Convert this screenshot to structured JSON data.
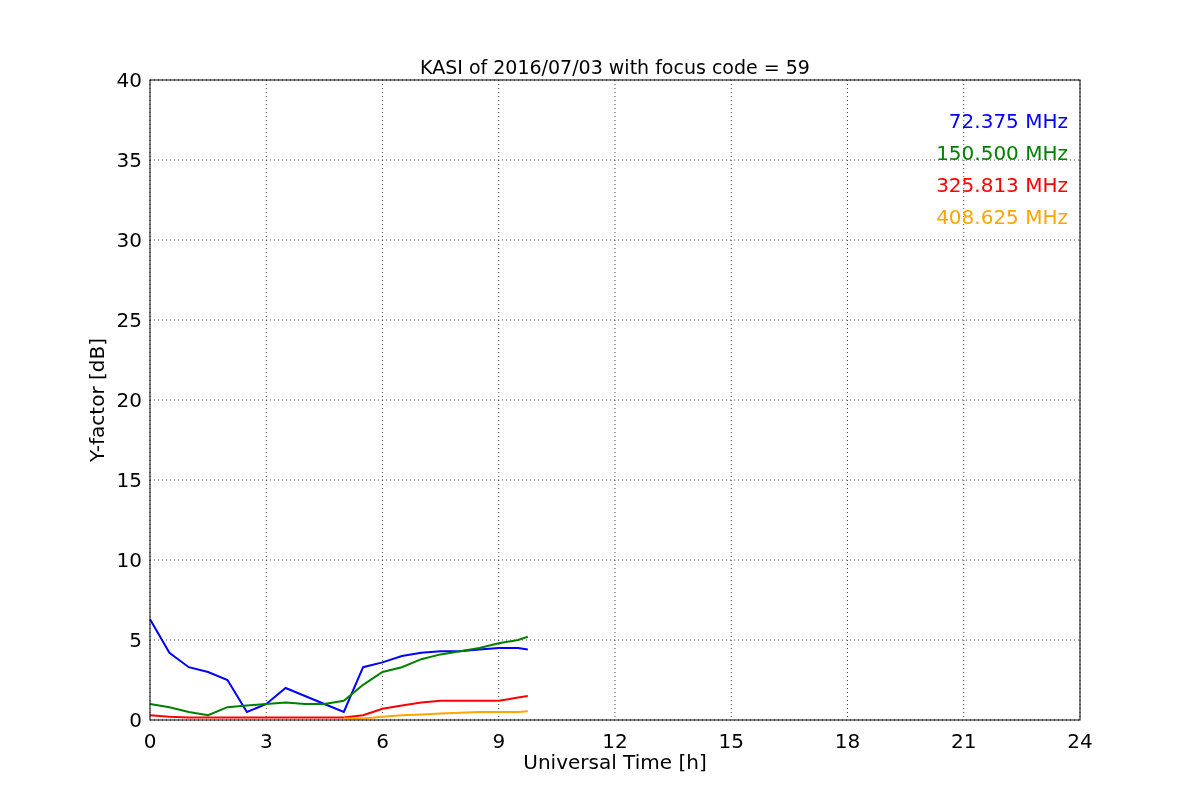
{
  "chart_data": {
    "type": "line",
    "title": "KASI of 2016/07/03 with focus code = 59",
    "xlabel": "Universal Time [h]",
    "ylabel": "Y-factor [dB]",
    "x": [
      0,
      0.5,
      1,
      1.5,
      2,
      2.5,
      3,
      3.5,
      4,
      4.5,
      5,
      5.5,
      6,
      6.5,
      7,
      7.5,
      8,
      8.5,
      9,
      9.5,
      9.75
    ],
    "series": [
      {
        "name": "72.375 MHz",
        "color": "#0000ff",
        "values": [
          6.3,
          4.2,
          3.3,
          3.0,
          2.5,
          0.5,
          1.0,
          2.0,
          1.5,
          1.0,
          0.5,
          3.3,
          3.6,
          4.0,
          4.2,
          4.3,
          4.3,
          4.4,
          4.5,
          4.5,
          4.4
        ]
      },
      {
        "name": "150.500 MHz",
        "color": "#008000",
        "values": [
          1.0,
          0.8,
          0.5,
          0.3,
          0.8,
          0.9,
          1.0,
          1.1,
          1.0,
          1.0,
          1.2,
          2.2,
          3.0,
          3.3,
          3.8,
          4.1,
          4.3,
          4.5,
          4.8,
          5.0,
          5.2
        ]
      },
      {
        "name": "325.813 MHz",
        "color": "#ff0000",
        "values": [
          0.3,
          0.2,
          0.15,
          0.15,
          0.15,
          0.15,
          0.15,
          0.15,
          0.15,
          0.15,
          0.15,
          0.3,
          0.7,
          0.9,
          1.1,
          1.2,
          1.2,
          1.2,
          1.2,
          1.4,
          1.5
        ]
      },
      {
        "name": "408.625 MHz",
        "color": "#ffa500",
        "values": [
          null,
          null,
          null,
          null,
          null,
          null,
          null,
          null,
          null,
          null,
          0.1,
          0.1,
          0.2,
          0.3,
          0.35,
          0.4,
          0.45,
          0.5,
          0.5,
          0.5,
          0.55
        ]
      }
    ],
    "grid": true,
    "xlim": [
      0,
      24
    ],
    "ylim": [
      0,
      40
    ],
    "xticks": [
      0,
      3,
      6,
      9,
      12,
      15,
      18,
      21,
      24
    ],
    "yticks": [
      0,
      5,
      10,
      15,
      20,
      25,
      30,
      35,
      40
    ]
  }
}
